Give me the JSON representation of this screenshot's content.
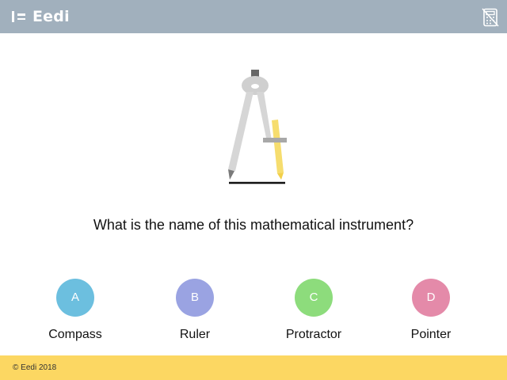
{
  "header": {
    "brand": "Eedi",
    "calculator_icon": "calculator-disabled-icon",
    "background": "#a1b0bd"
  },
  "illustration": {
    "icon": "drawing-compass-icon"
  },
  "question": {
    "text": "What is the name of this mathematical instrument?"
  },
  "answers": [
    {
      "letter": "A",
      "label": "Compass",
      "color": "#6cbfdf"
    },
    {
      "letter": "B",
      "label": "Ruler",
      "color": "#9aa3e2"
    },
    {
      "letter": "C",
      "label": "Protractor",
      "color": "#8ddc7c"
    },
    {
      "letter": "D",
      "label": "Pointer",
      "color": "#e48aa9"
    }
  ],
  "footer": {
    "copyright": "© Eedi 2018",
    "background": "#fcd762"
  }
}
